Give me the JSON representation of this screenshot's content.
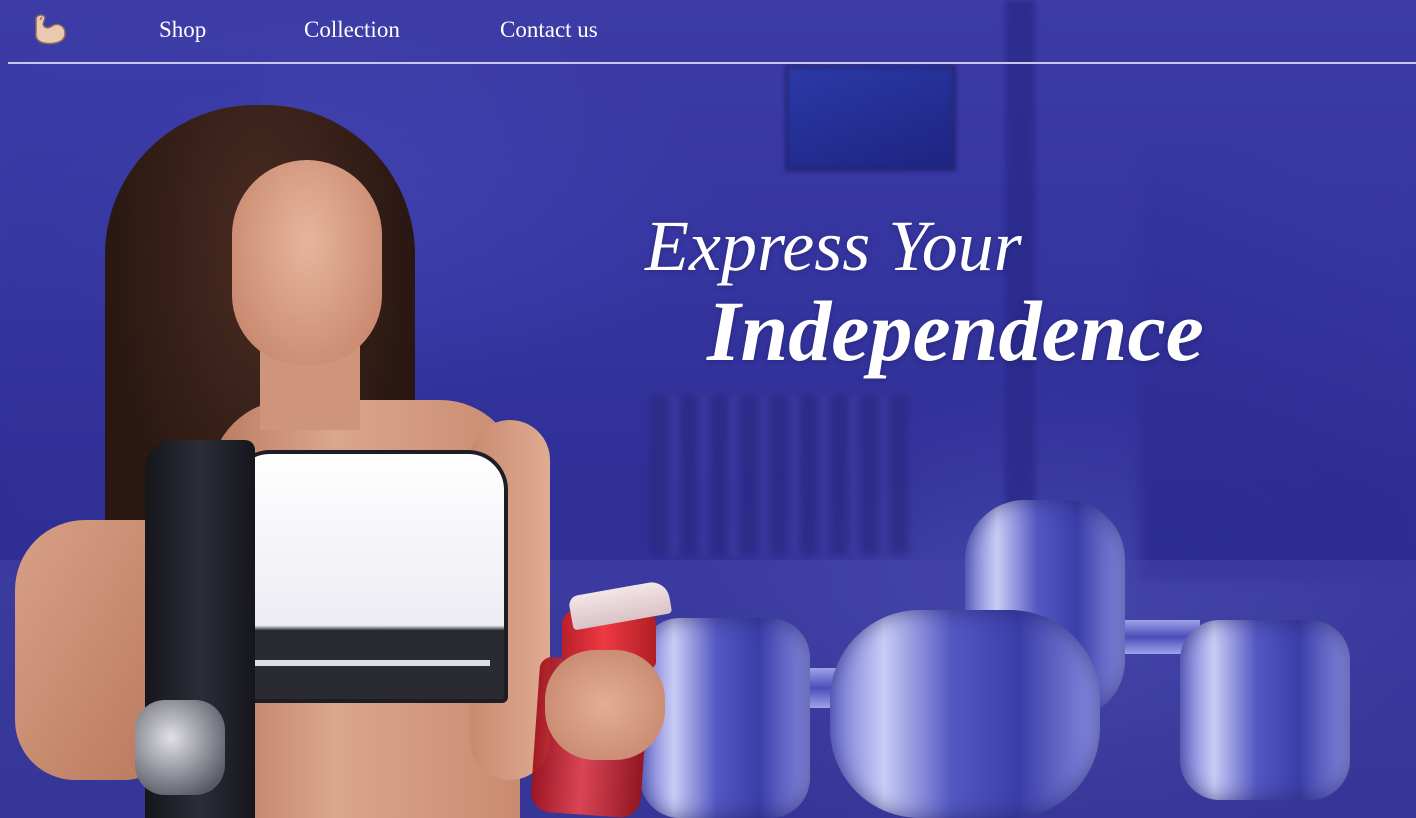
{
  "nav": {
    "logo_icon": "flexed-bicep-icon",
    "links": [
      {
        "label": "Shop"
      },
      {
        "label": "Collection"
      },
      {
        "label": "Contact us"
      }
    ]
  },
  "hero": {
    "headline_line1": "Express Your",
    "headline_line2": "Independence",
    "overlay_color": "#3434a0",
    "text_color": "#ffffff",
    "image_subject": "woman-with-shaker-bottle-in-gym"
  }
}
